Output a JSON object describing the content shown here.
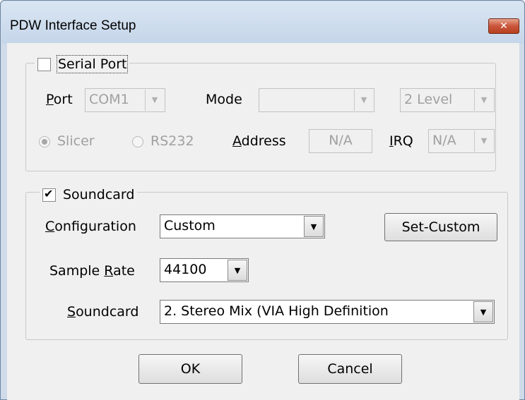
{
  "window": {
    "title": "PDW Interface Setup",
    "close_glyph": "✕"
  },
  "serial": {
    "label": "Serial Port",
    "checked": false,
    "port_label": "Port",
    "port_value": "COM1",
    "mode_label": "Mode",
    "mode_value": "",
    "level_value": "2 Level",
    "slicer_label": "Slicer",
    "rs232_label": "RS232",
    "address_label": "Address",
    "address_value": "N/A",
    "irq_label": "IRQ",
    "irq_value": "N/A"
  },
  "soundcard": {
    "label": "Soundcard",
    "checked": true,
    "configuration_label": "Configuration",
    "configuration_value": "Custom",
    "set_custom_label": "Set-Custom",
    "sample_rate_label": "Sample Rate",
    "sample_rate_value": "44100",
    "device_label": "Soundcard",
    "device_value": "2. Stereo Mix (VIA High Definition"
  },
  "buttons": {
    "ok": "OK",
    "cancel": "Cancel"
  },
  "icons": {
    "dropdown": "▼",
    "checkmark": "✔"
  }
}
